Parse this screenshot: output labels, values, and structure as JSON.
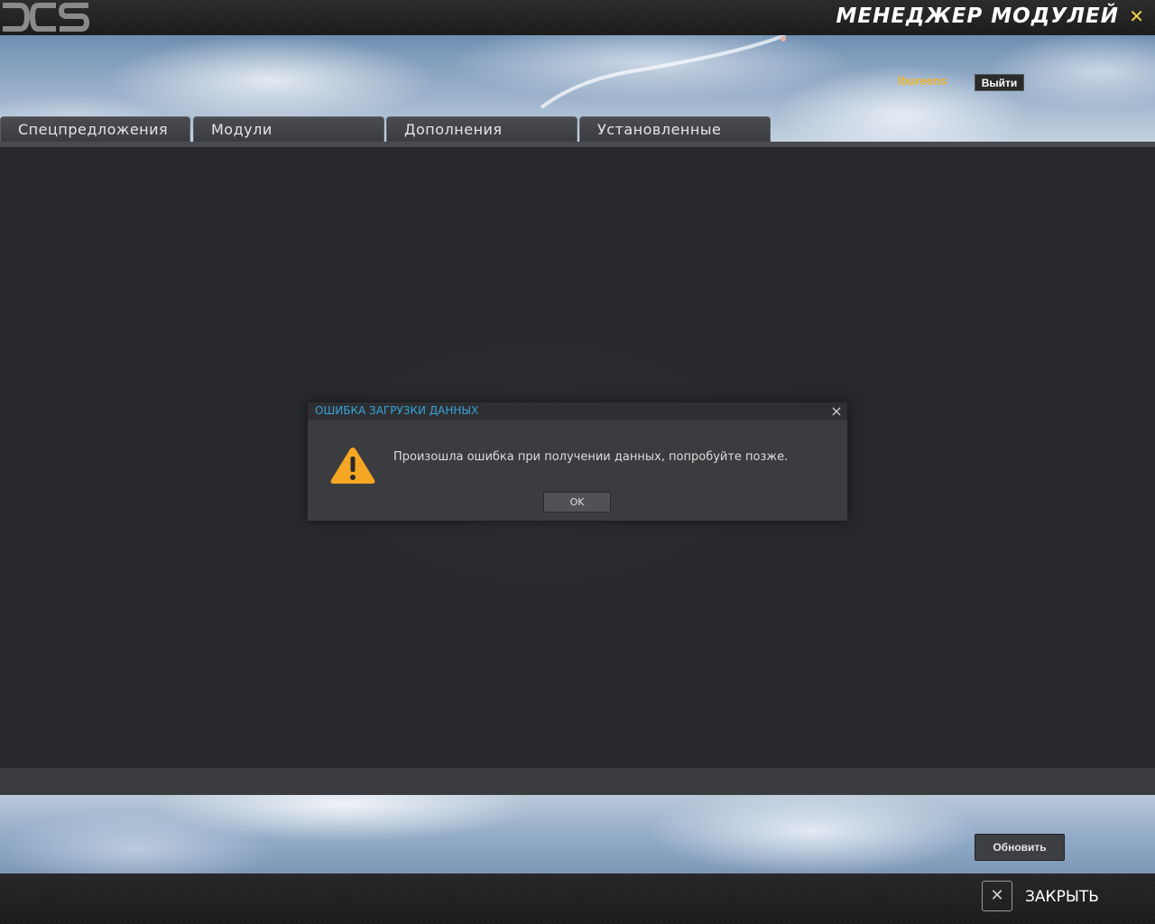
{
  "window": {
    "title": "МЕНЕДЖЕР МОДУЛЕЙ",
    "close_icon": "close-icon",
    "logo_text": "DCS"
  },
  "account": {
    "username": "lbureens",
    "logout_label": "Выйти"
  },
  "tabs": [
    {
      "label": "Спецпредложения"
    },
    {
      "label": "Модули"
    },
    {
      "label": "Дополнения"
    },
    {
      "label": "Установленные"
    }
  ],
  "dialog": {
    "title": "ОШИБКА ЗАГРУЗКИ ДАННЫХ",
    "message": "Произошла ошибка при получении данных, попробуйте позже.",
    "ok_label": "OK",
    "icon": "warning-icon"
  },
  "footer": {
    "refresh_label": "Обновить",
    "close_label": "ЗАКРЫТЬ"
  },
  "colors": {
    "accent_yellow": "#f5d24a",
    "username_orange": "#f0b429",
    "dialog_title_blue": "#36a3d9",
    "warning_orange": "#f5a623"
  }
}
